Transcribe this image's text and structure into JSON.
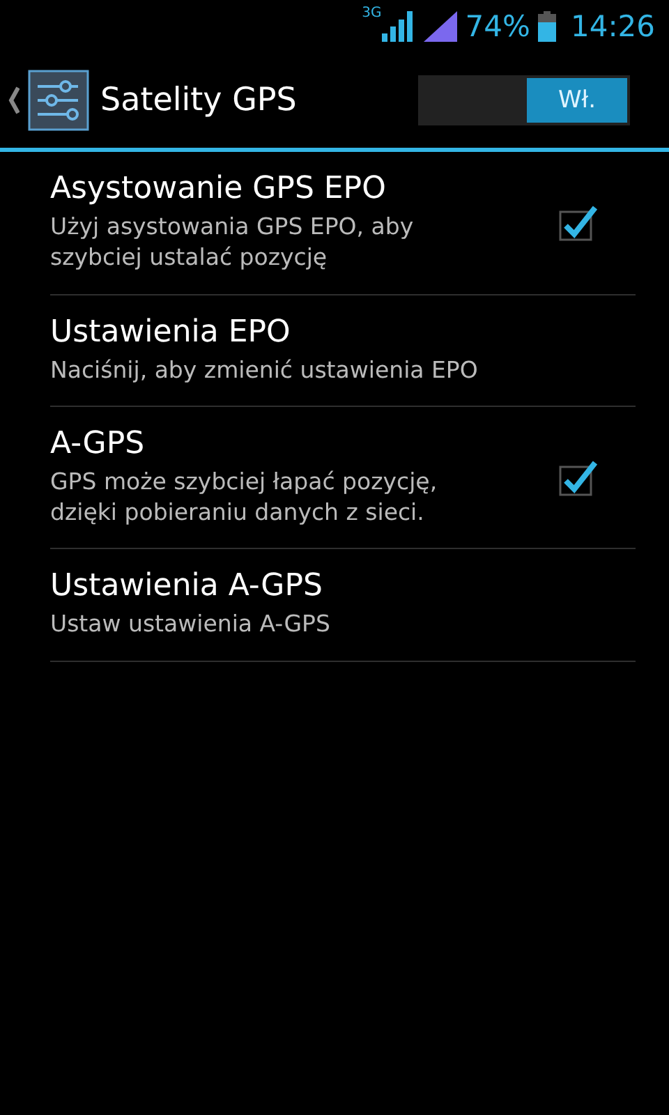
{
  "status_bar": {
    "network": "3G",
    "battery": "74%",
    "time": "14:26"
  },
  "action_bar": {
    "title": "Satelity GPS",
    "switch": {
      "label": "Wł.",
      "on": true
    }
  },
  "items": [
    {
      "kind": "checkbox",
      "title": "Asystowanie GPS EPO",
      "summary": "Użyj asystowania GPS EPO, aby szybciej ustalać pozycję",
      "checked": true
    },
    {
      "kind": "plain",
      "title": "Ustawienia EPO",
      "summary": "Naciśnij, aby zmienić ustawienia EPO"
    },
    {
      "kind": "checkbox",
      "title": "A-GPS",
      "summary": "GPS może szybciej łapać pozycję, dzięki pobieraniu danych z sieci.",
      "checked": true
    },
    {
      "kind": "plain",
      "title": "Ustawienia A-GPS",
      "summary": "Ustaw ustawienia A-GPS"
    }
  ]
}
